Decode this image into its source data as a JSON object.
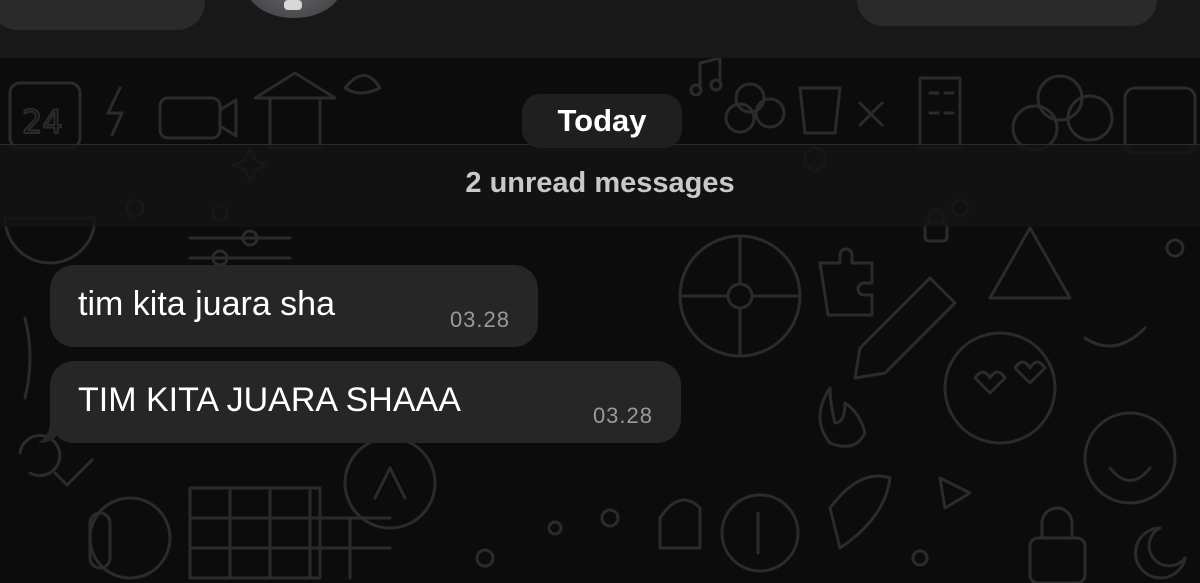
{
  "chat": {
    "date_separator": "Today",
    "unread_banner": "2 unread messages",
    "messages": [
      {
        "text": "tim kita juara sha",
        "time": "03.28",
        "direction": "incoming"
      },
      {
        "text": "TIM KITA JUARA SHAAA",
        "time": "03.28",
        "direction": "incoming"
      }
    ]
  },
  "colors": {
    "background": "#0c0c0c",
    "header": "#181818",
    "bubble": "#262626",
    "text": "#ffffff",
    "time": "#9a9a9a",
    "doodle": "#2b2b2b"
  },
  "icons": [
    "back-button",
    "contact-avatar",
    "call-actions",
    "wallpaper-doodles"
  ]
}
